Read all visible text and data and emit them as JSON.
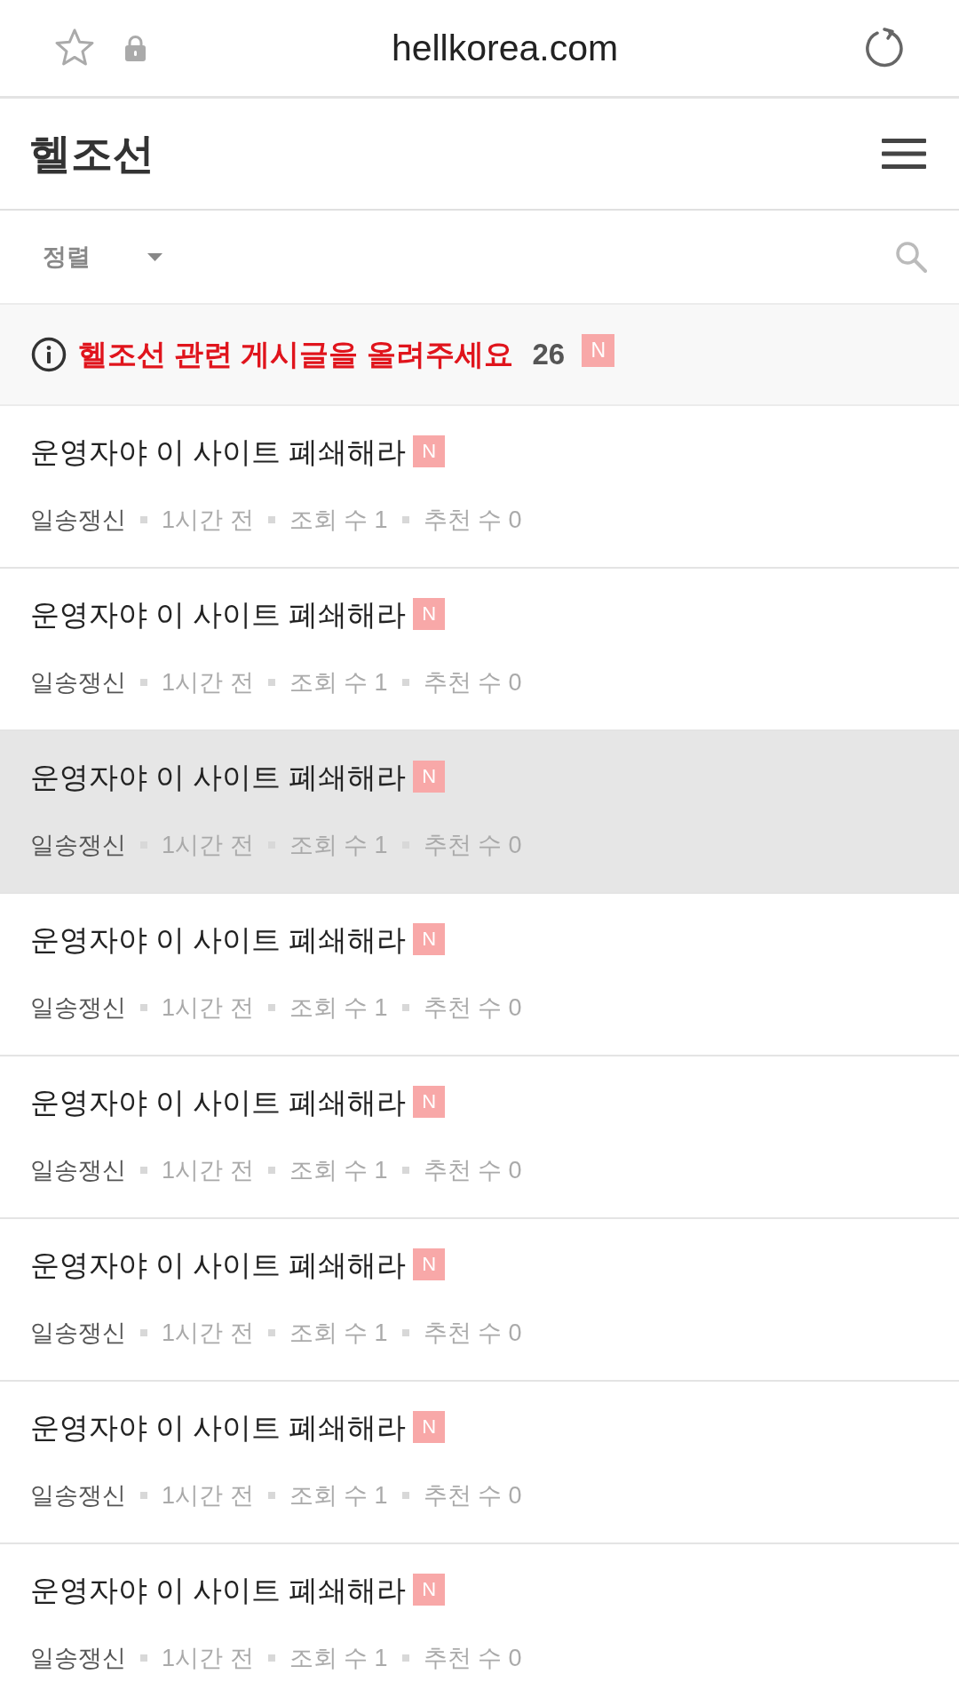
{
  "browser_bar": {
    "url": "hellkorea.com"
  },
  "header": {
    "title": "헬조선"
  },
  "toolbar": {
    "sort_label": "정렬"
  },
  "notice": {
    "text": "헬조선 관련 게시글을 올려주세요",
    "count": "26",
    "badge": "N"
  },
  "posts": [
    {
      "title": "운영자야 이 사이트 폐쇄해라",
      "badge": "N",
      "author": "일송쟁신",
      "time": "1시간 전",
      "views": "조회 수 1",
      "likes": "추천 수 0",
      "highlighted": false
    },
    {
      "title": "운영자야 이 사이트 폐쇄해라",
      "badge": "N",
      "author": "일송쟁신",
      "time": "1시간 전",
      "views": "조회 수 1",
      "likes": "추천 수 0",
      "highlighted": false
    },
    {
      "title": "운영자야 이 사이트 폐쇄해라",
      "badge": "N",
      "author": "일송쟁신",
      "time": "1시간 전",
      "views": "조회 수 1",
      "likes": "추천 수 0",
      "highlighted": true
    },
    {
      "title": "운영자야 이 사이트 폐쇄해라",
      "badge": "N",
      "author": "일송쟁신",
      "time": "1시간 전",
      "views": "조회 수 1",
      "likes": "추천 수 0",
      "highlighted": false
    },
    {
      "title": "운영자야 이 사이트 폐쇄해라",
      "badge": "N",
      "author": "일송쟁신",
      "time": "1시간 전",
      "views": "조회 수 1",
      "likes": "추천 수 0",
      "highlighted": false
    },
    {
      "title": "운영자야 이 사이트 폐쇄해라",
      "badge": "N",
      "author": "일송쟁신",
      "time": "1시간 전",
      "views": "조회 수 1",
      "likes": "추천 수 0",
      "highlighted": false
    },
    {
      "title": "운영자야 이 사이트 폐쇄해라",
      "badge": "N",
      "author": "일송쟁신",
      "time": "1시간 전",
      "views": "조회 수 1",
      "likes": "추천 수 0",
      "highlighted": false
    },
    {
      "title": "운영자야 이 사이트 폐쇄해라",
      "badge": "N",
      "author": "일송쟁신",
      "time": "1시간 전",
      "views": "조회 수 1",
      "likes": "추천 수 0",
      "highlighted": false
    }
  ]
}
